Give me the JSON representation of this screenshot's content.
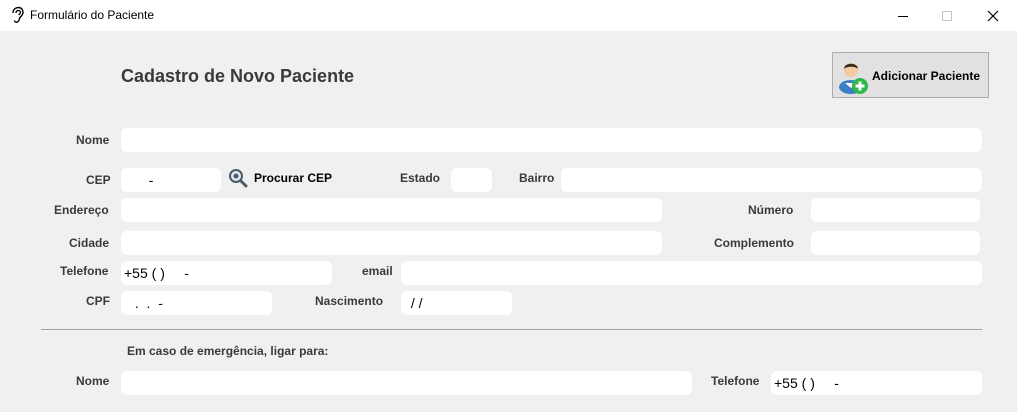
{
  "window": {
    "title": "Formulário do Paciente"
  },
  "form": {
    "heading": "Cadastro de Novo Paciente",
    "add_button_label": "Adicionar Paciente",
    "search_cep_label": "Procurar CEP",
    "emergency_heading": "Em caso de emergência, ligar para:"
  },
  "labels": {
    "nome": "Nome",
    "cep": "CEP",
    "estado": "Estado",
    "bairro": "Bairro",
    "endereco": "Endereço",
    "numero": "Número",
    "cidade": "Cidade",
    "complemento": "Complemento",
    "telefone": "Telefone",
    "email": "email",
    "cpf": "CPF",
    "nascimento": "Nascimento",
    "emergency_nome": "Nome",
    "emergency_telefone": "Telefone"
  },
  "values": {
    "nome": "",
    "cep": "  -",
    "estado": "",
    "bairro": "",
    "endereco": "",
    "numero": "",
    "cidade": "",
    "complemento": "",
    "telefone": "+55 ( )     -",
    "email": "",
    "cpf": " .  .  -",
    "nascimento": " / /",
    "emergency_nome": "",
    "emergency_telefone": "+55 ( )     -"
  },
  "colors": {
    "background": "#f0f0f0",
    "input_background": "#ffffff",
    "label_text": "#3a3a3a",
    "add_icon_green": "#2db84a"
  },
  "icons": {
    "app": "ear-icon",
    "add": "add-user-icon",
    "search": "magnifier-icon"
  }
}
